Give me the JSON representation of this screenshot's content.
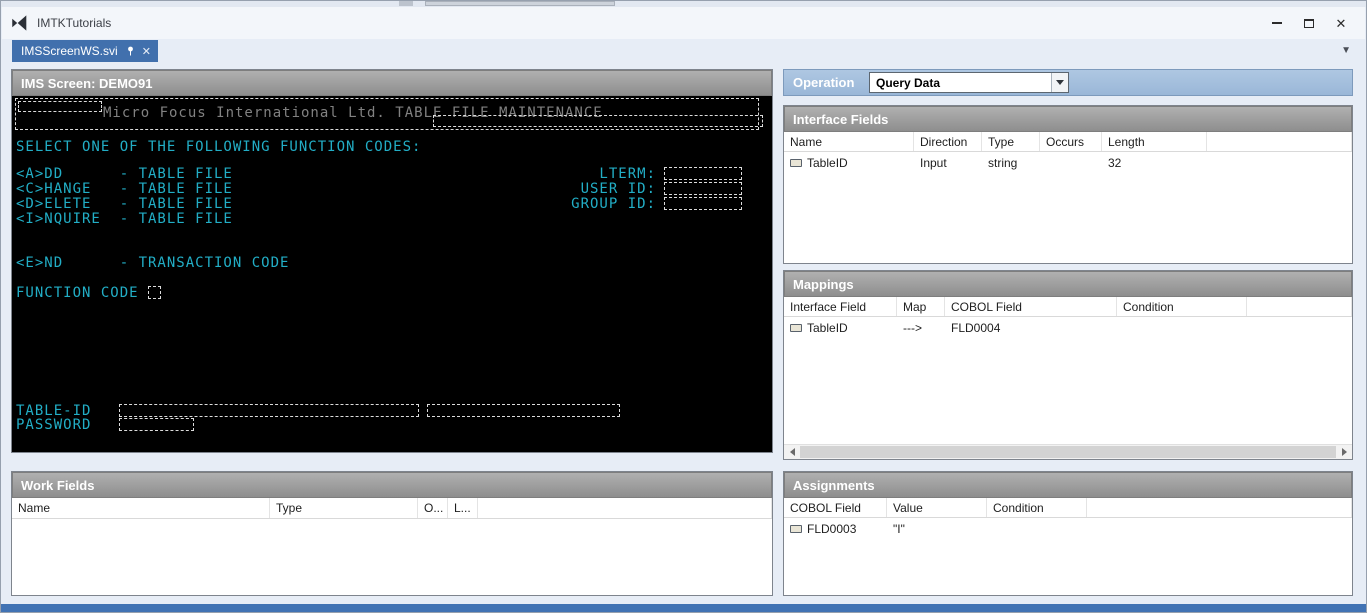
{
  "window": {
    "title": "IMTKTutorials",
    "tab_label": "IMSScreenWS.svi"
  },
  "screen": {
    "header": "IMS Screen: DEMO91",
    "banner": "Micro Focus International Ltd. TABLE FILE MAINTENANCE",
    "select_line": "SELECT ONE OF THE FOLLOWING FUNCTION CODES:",
    "options": [
      "<A>DD      - TABLE FILE",
      "<C>HANGE   - TABLE FILE",
      "<D>ELETE   - TABLE FILE",
      "<I>NQUIRE  - TABLE FILE"
    ],
    "end_option": "<E>ND      - TRANSACTION CODE",
    "lterm_label": "LTERM:",
    "user_id_label": "USER ID:",
    "group_id_label": "GROUP ID:",
    "function_code_label": "FUNCTION CODE",
    "table_id_label": "TABLE-ID",
    "password_label": "PASSWORD"
  },
  "work_fields": {
    "title": "Work Fields",
    "columns": [
      "Name",
      "Type",
      "O...",
      "L..."
    ]
  },
  "operation": {
    "label": "Operation",
    "value": "Query Data"
  },
  "interface_fields": {
    "title": "Interface Fields",
    "columns": [
      "Name",
      "Direction",
      "Type",
      "Occurs",
      "Length"
    ],
    "rows": [
      {
        "name": "TableID",
        "direction": "Input",
        "type": "string",
        "occurs": "",
        "length": "32"
      }
    ]
  },
  "mappings": {
    "title": "Mappings",
    "columns": [
      "Interface Field",
      "Map",
      "COBOL Field",
      "Condition"
    ],
    "rows": [
      {
        "interface_field": "TableID",
        "map": "--->",
        "cobol_field": "FLD0004",
        "condition": ""
      }
    ]
  },
  "assignments": {
    "title": "Assignments",
    "columns": [
      "COBOL Field",
      "Value",
      "Condition"
    ],
    "rows": [
      {
        "cobol_field": "FLD0003",
        "value": "\"I\"",
        "condition": ""
      }
    ]
  }
}
